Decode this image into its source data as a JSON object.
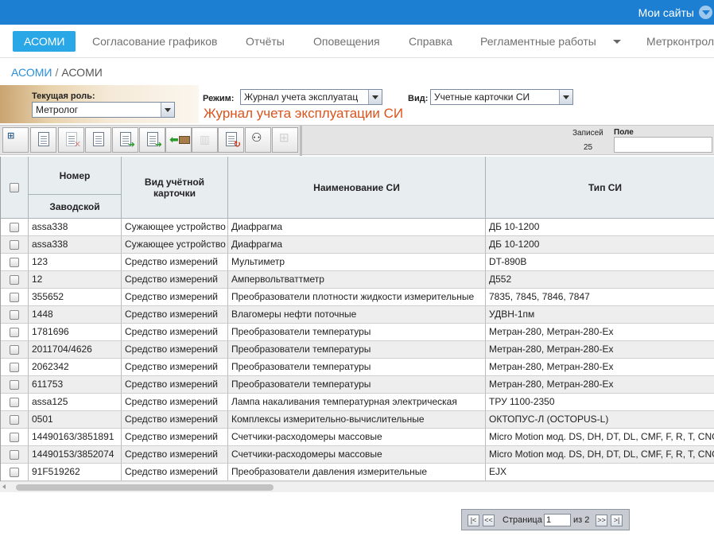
{
  "topbar": {
    "my_sites": "Мои сайты"
  },
  "nav": {
    "items": [
      "АСОМИ",
      "Согласование графиков",
      "Отчёты",
      "Оповещения",
      "Справка",
      "Регламентные работы",
      "Метрконтроль"
    ]
  },
  "breadcrumb": {
    "root": "АСОМИ",
    "separator": "/",
    "current": "АСОМИ"
  },
  "role": {
    "label": "Текущая роль:",
    "value": "Метролог"
  },
  "mode": {
    "label": "Режим:",
    "value": "Журнал учета эксплуатац"
  },
  "view": {
    "label": "Вид:",
    "value": "Учетные карточки СИ"
  },
  "journal_title": "Журнал учета эксплуатации СИ",
  "toolbar": {
    "records_label": "Записей",
    "records_count": "25",
    "field_label": "Поле",
    "field_value": ""
  },
  "table": {
    "headers": {
      "number": "Номер",
      "serial": "Заводской",
      "card_type": "Вид учётной карточки",
      "name": "Наименование СИ",
      "type": "Тип СИ"
    },
    "rows": [
      {
        "serial": "assa338",
        "card": "Сужающее устройство",
        "name": "Диафрагма",
        "type": "ДБ 10-1200"
      },
      {
        "serial": "assa338",
        "card": "Сужающее устройство",
        "name": "Диафрагма",
        "type": "ДБ 10-1200"
      },
      {
        "serial": "123",
        "card": "Средство измерений",
        "name": "Мультиметр",
        "type": "DT-890B"
      },
      {
        "serial": "12",
        "card": "Средство измерений",
        "name": "Ампервольтваттметр",
        "type": "Д552"
      },
      {
        "serial": "355652",
        "card": "Средство измерений",
        "name": "Преобразователи плотности жидкости измерительные",
        "type": "7835, 7845, 7846, 7847"
      },
      {
        "serial": "1448",
        "card": "Средство измерений",
        "name": "Влагомеры нефти поточные",
        "type": "УДВН-1пм"
      },
      {
        "serial": "1781696",
        "card": "Средство измерений",
        "name": "Преобразователи температуры",
        "type": "Метран-280, Метран-280-Ех"
      },
      {
        "serial": "2011704/4626",
        "card": "Средство измерений",
        "name": "Преобразователи температуры",
        "type": "Метран-280, Метран-280-Ех"
      },
      {
        "serial": "2062342",
        "card": "Средство измерений",
        "name": "Преобразователи температуры",
        "type": "Метран-280, Метран-280-Ех"
      },
      {
        "serial": "611753",
        "card": "Средство измерений",
        "name": "Преобразователи температуры",
        "type": "Метран-280, Метран-280-Ех"
      },
      {
        "serial": "assa125",
        "card": "Средство измерений",
        "name": "Лампа накаливания температурная электрическая",
        "type": "ТРУ 1100-2350"
      },
      {
        "serial": "0501",
        "card": "Средство измерений",
        "name": "Комплексы измерительно-вычислительные",
        "type": "ОКТОПУС-Л (OCTOPUS-L)"
      },
      {
        "serial": "14490163/3851891",
        "card": "Средство измерений",
        "name": "Счетчики-расходомеры массовые",
        "type": "Micro Motion мод. DS, DH, DT, DL, CMF, F, R, T, CNG"
      },
      {
        "serial": "14490153/3852074",
        "card": "Средство измерений",
        "name": "Счетчики-расходомеры массовые",
        "type": "Micro Motion мод. DS, DH, DT, DL, CMF, F, R, T, CNG"
      },
      {
        "serial": "91F519262",
        "card": "Средство измерений",
        "name": "Преобразователи давления измерительные",
        "type": "EJX"
      }
    ]
  },
  "pager": {
    "page_label": "Страница",
    "page_value": "1",
    "of_label": "из 2",
    "first": "|<",
    "prev": "<<",
    "next": ">>",
    "last": ">|"
  },
  "colors": {
    "topbar": "#1d7fd1",
    "nav_active": "#2aa7e6",
    "journal_title": "#d9541c",
    "breadcrumb_link": "#2a8ed8"
  }
}
